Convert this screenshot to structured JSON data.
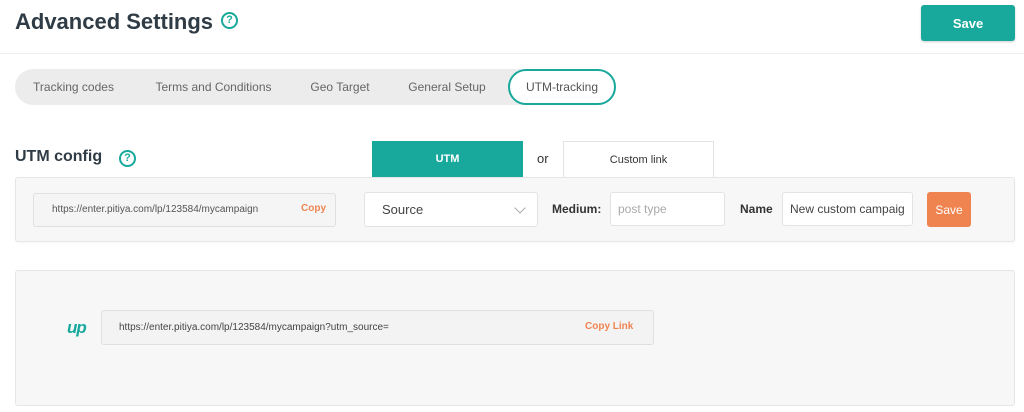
{
  "header": {
    "title": "Advanced Settings",
    "help_glyph": "?",
    "save_label": "Save"
  },
  "tabs": [
    {
      "label": "Tracking codes"
    },
    {
      "label": "Terms and Conditions"
    },
    {
      "label": "Geo Target"
    },
    {
      "label": "General Setup"
    },
    {
      "label": "UTM-tracking",
      "active": true
    }
  ],
  "utm_config": {
    "heading": "UTM config",
    "help_glyph": "?",
    "utm_tab_label": "UTM",
    "or_label": "or",
    "custom_tab_label": "Custom link",
    "url": "https://enter.pitiya.com/lp/123584/mycampaign",
    "copy_label": "Copy",
    "source_selected": "Source",
    "medium_label": "Medium:",
    "medium_placeholder": "post type",
    "name_label": "Name",
    "name_value": "New custom campaign",
    "save_label": "Save"
  },
  "preview": {
    "logo": "up",
    "link": "https://enter.pitiya.com/lp/123584/mycampaign?utm_source=",
    "copy_link_label": "Copy Link"
  },
  "colors": {
    "accent": "#18a99c",
    "orange": "#ef8451"
  }
}
